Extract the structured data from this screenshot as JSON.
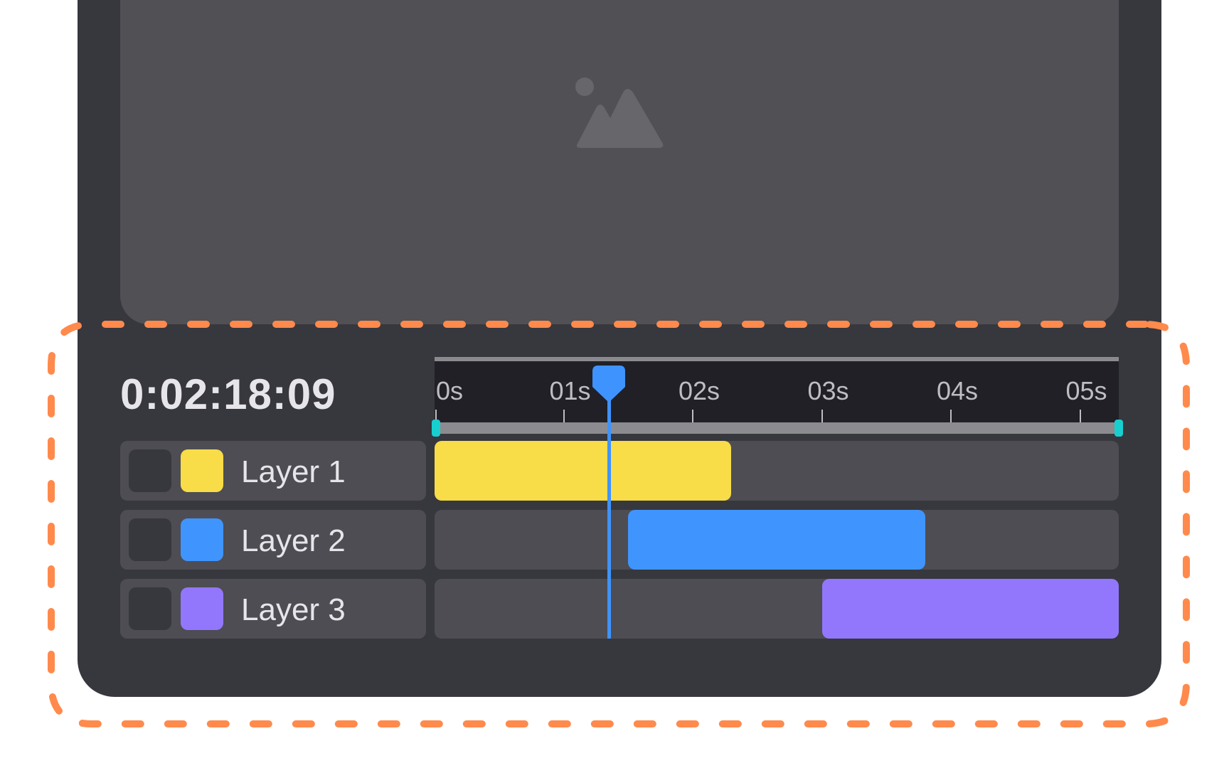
{
  "colors": {
    "accent_outline": "#ff8a4c",
    "playhead": "#3f93ff",
    "range_handle": "#18cfd0"
  },
  "preview": {
    "icon": "image-placeholder-icon"
  },
  "timeline": {
    "timecode": "0:02:18:09",
    "ruler_labels": [
      "0s",
      "01s",
      "02s",
      "03s",
      "04s",
      "05s"
    ],
    "playhead_seconds": 1.35,
    "range_start_seconds": 0,
    "range_end_seconds": 5.3
  },
  "layers": [
    {
      "name": "Layer 1",
      "color": "#f8dc48",
      "start_s": 0,
      "end_s": 2.3
    },
    {
      "name": "Layer 2",
      "color": "#3f95fd",
      "start_s": 1.5,
      "end_s": 3.8
    },
    {
      "name": "Layer 3",
      "color": "#9277fd",
      "start_s": 3.0,
      "end_s": 5.3
    }
  ]
}
